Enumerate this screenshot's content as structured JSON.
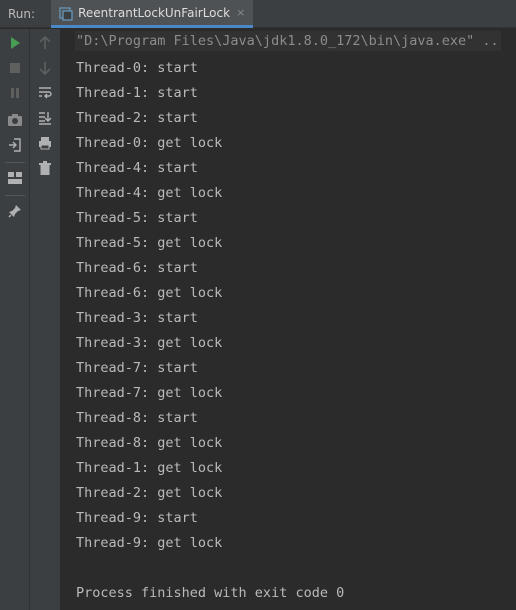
{
  "header": {
    "run_label": "Run:",
    "tab": {
      "label": "ReentrantLockUnFairLock",
      "close": "×"
    }
  },
  "toolbar_primary": [
    {
      "icon": "run-icon",
      "color": "#499c54"
    },
    {
      "icon": "stop-icon",
      "color": "#6e6e6e"
    },
    {
      "icon": "pause-icon",
      "color": "#6e6e6e"
    },
    {
      "icon": "camera-icon",
      "color": "#afb1b3"
    },
    {
      "icon": "exit-icon",
      "color": "#afb1b3"
    },
    {
      "icon": "layout-icon",
      "color": "#afb1b3"
    },
    {
      "icon": "pin-icon",
      "color": "#afb1b3"
    }
  ],
  "toolbar_secondary": [
    {
      "icon": "up-arrow-icon",
      "color": "#6e6e6e"
    },
    {
      "icon": "down-arrow-icon",
      "color": "#6e6e6e"
    },
    {
      "icon": "soft-wrap-icon",
      "color": "#afb1b3"
    },
    {
      "icon": "scroll-to-end-icon",
      "color": "#afb1b3"
    },
    {
      "icon": "print-icon",
      "color": "#afb1b3"
    },
    {
      "icon": "trash-icon",
      "color": "#afb1b3"
    }
  ],
  "console": {
    "command": "\"D:\\Program Files\\Java\\jdk1.8.0_172\\bin\\java.exe\" ...",
    "lines": [
      "Thread-0: start",
      "Thread-1: start",
      "Thread-2: start",
      "Thread-0: get lock",
      "Thread-4: start",
      "Thread-4: get lock",
      "Thread-5: start",
      "Thread-5: get lock",
      "Thread-6: start",
      "Thread-6: get lock",
      "Thread-3: start",
      "Thread-3: get lock",
      "Thread-7: start",
      "Thread-7: get lock",
      "Thread-8: start",
      "Thread-8: get lock",
      "Thread-1: get lock",
      "Thread-2: get lock",
      "Thread-9: start",
      "Thread-9: get lock"
    ],
    "exit_message": "Process finished with exit code 0"
  },
  "colors": {
    "background": "#2b2b2b",
    "panel": "#3c3f41",
    "tab_underline": "#4a88c7",
    "text": "#bababa"
  }
}
